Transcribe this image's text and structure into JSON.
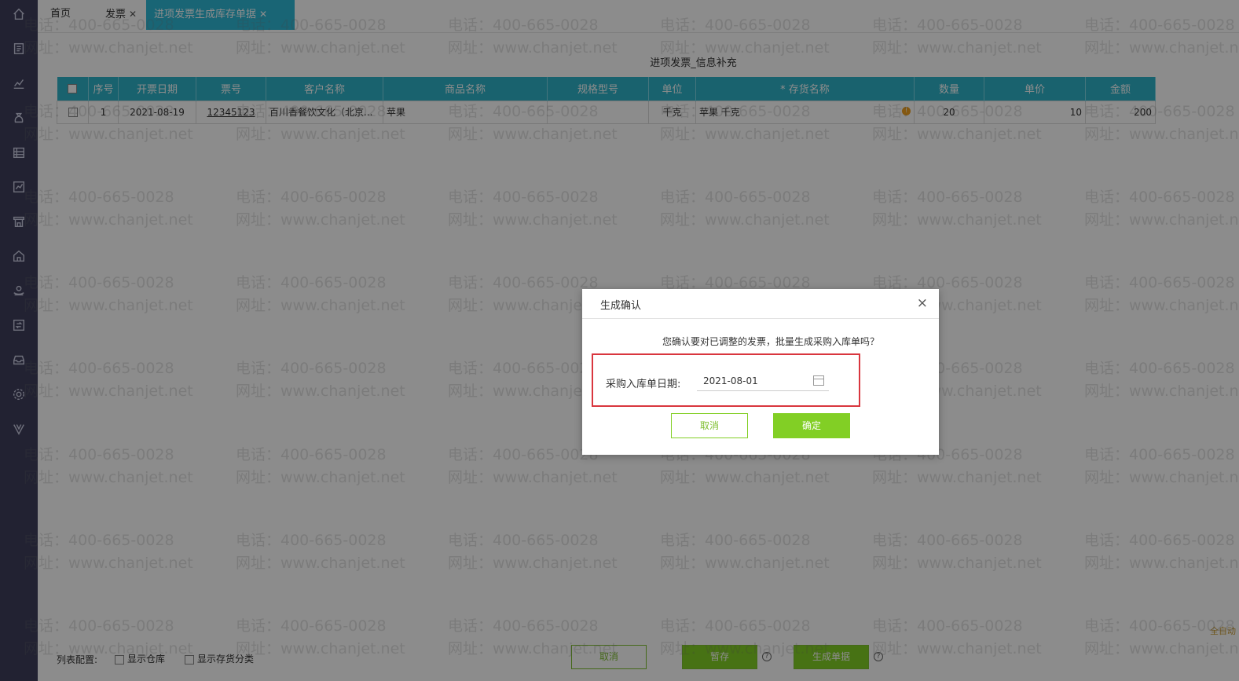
{
  "tabs": [
    {
      "label": "首页",
      "closable": false
    },
    {
      "label": "发票",
      "closable": true
    },
    {
      "label": "进项发票生成库存单据",
      "closable": true,
      "active": true
    }
  ],
  "page": {
    "title": "进项发票_信息补充"
  },
  "table": {
    "columns": [
      "序号",
      "开票日期",
      "票号",
      "客户名称",
      "商品名称",
      "规格型号",
      "单位",
      "* 存货名称",
      "数量",
      "单价",
      "金额"
    ],
    "rows": [
      {
        "seq": "1",
        "date": "2021-08-19",
        "invoice_no": "12345123",
        "customer": "百川香餐饮文化（北京...",
        "product": "苹果",
        "spec": "",
        "unit": "千克",
        "inventory": "苹果 千克",
        "qty": "20",
        "price": "10",
        "amount": "200"
      }
    ]
  },
  "footer": {
    "config_label": "列表配置:",
    "show_warehouse": "显示仓库",
    "show_category": "显示存货分类",
    "cancel": "取消",
    "save": "暂存",
    "generate": "生成单据",
    "auto_label": "全自动"
  },
  "watermark": {
    "phone": "电话：400-665-0028",
    "site": "网址：www.chanjet.net"
  },
  "dialog": {
    "title": "生成确认",
    "close": "×",
    "message": "您确认要对已调整的发票，批量生成采购入库单吗？",
    "date_label": "采购入库单日期:",
    "date_value": "2021-08-01",
    "cancel": "取消",
    "confirm": "确定"
  },
  "colors": {
    "accent": "#2fb9d6",
    "green": "#82cf25",
    "sidebar": "#3e3f5b",
    "highlight": "#d9363e"
  }
}
